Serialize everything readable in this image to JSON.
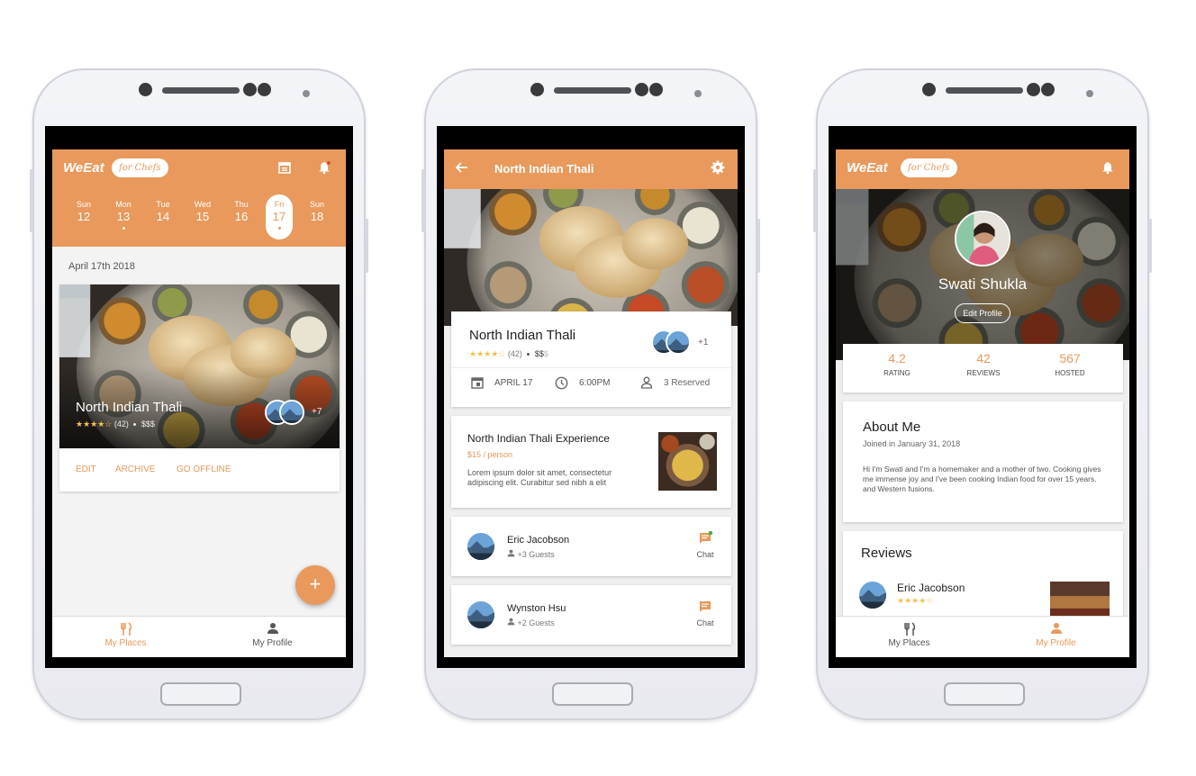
{
  "screens": {
    "places": {
      "logo": "WeEat",
      "badge": "for Chefs",
      "icons": [
        "calendar-icon",
        "bell-icon"
      ],
      "days": [
        {
          "name": "Sun",
          "date": "12"
        },
        {
          "name": "Mon",
          "date": "13"
        },
        {
          "name": "Tue",
          "date": "14"
        },
        {
          "name": "Wed",
          "date": "15"
        },
        {
          "name": "Thu",
          "date": "16"
        },
        {
          "name": "Fri",
          "date": "17"
        },
        {
          "name": "Sun",
          "date": "18"
        }
      ],
      "date_heading": "April 17th 2018",
      "card": {
        "title": "North Indian Thali",
        "stars": "★★★★☆",
        "reviews": "(42)",
        "price": "$$$",
        "guests_more": "+7",
        "actions": [
          "EDIT",
          "ARCHIVE",
          "GO OFFLINE"
        ]
      },
      "fab": "+",
      "nav": {
        "my_places": "My Places",
        "my_profile": "My Profile"
      }
    },
    "detail": {
      "title": "North Indian Thali",
      "back_icon": "arrow-back-icon",
      "settings_icon": "gear-icon",
      "card": {
        "title": "North Indian Thali",
        "stars": "★★★★☆",
        "reviews": "(42)",
        "price": "$$",
        "price_dim": "$",
        "guests_more": "+1",
        "date": "APRIL 17",
        "time": "6:00PM",
        "reserved": "3 Reserved"
      },
      "experience": {
        "title": "North Indian Thali Experience",
        "price": "$15 / person",
        "description": "Lorem ipsum dolor sit amet, consectetur adipiscing elit. Curabitur sed nibh a elit"
      },
      "guests": [
        {
          "name": "Eric Jacobson",
          "extra": "+3 Guests",
          "chat": "Chat"
        },
        {
          "name": "Wynston Hsu",
          "extra": "+2 Guests",
          "chat": "Chat"
        }
      ]
    },
    "profile": {
      "logo": "WeEat",
      "badge": "for Chefs",
      "name": "Swati Shukla",
      "edit": "Edit Profile",
      "stats": [
        {
          "value": "4.2",
          "label": "RATING"
        },
        {
          "value": "42",
          "label": "REVIEWS"
        },
        {
          "value": "567",
          "label": "HOSTED"
        }
      ],
      "about_title": "About Me",
      "joined": "Joined in January 31, 2018",
      "bio": "Hi I'm Swati and I'm a homemaker and a mother of two. Cooking gives me immense joy and I've been cooking Indian food for over 15 years. and Western fusions.",
      "reviews_title": "Reviews",
      "review": {
        "name": "Eric Jacobson",
        "stars": "★★★★☆"
      },
      "nav": {
        "my_places": "My Places",
        "my_profile": "My Profile"
      }
    }
  },
  "colors": {
    "accent": "#e8995b",
    "star": "#f3c24d",
    "online": "#4caf50"
  }
}
